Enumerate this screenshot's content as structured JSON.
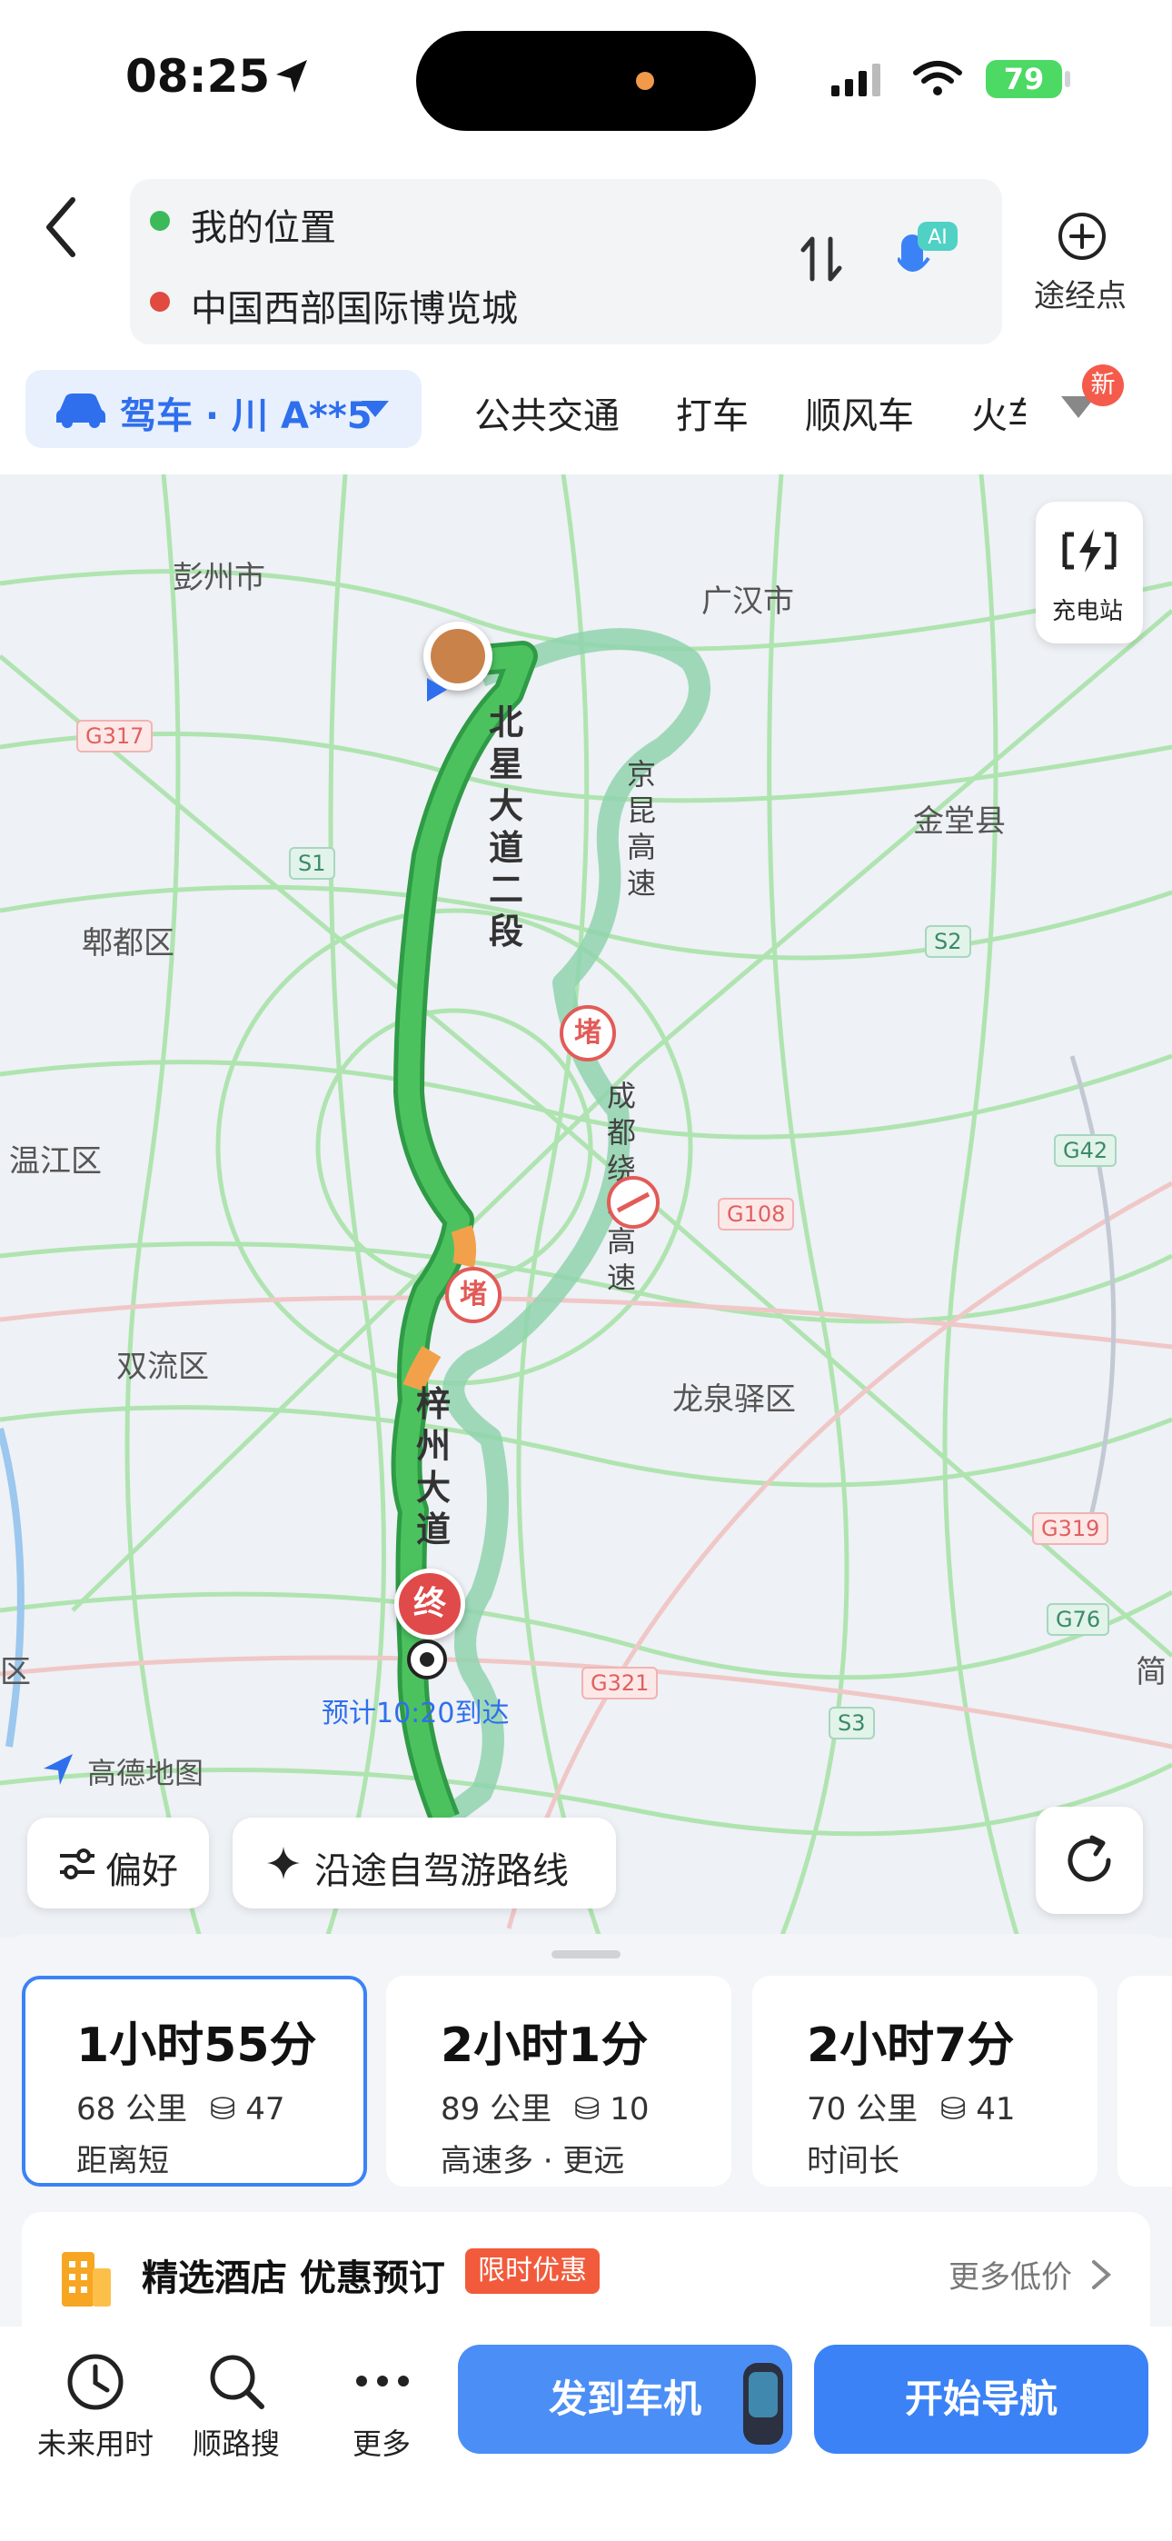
{
  "status_bar": {
    "time": "08:25",
    "battery": "79"
  },
  "header": {
    "origin": "我的位置",
    "destination": "中国西部国际博览城",
    "waypoint_label": "途经点"
  },
  "modes": {
    "drive": "驾车 · 川 A**5",
    "tabs": [
      "公共交通",
      "打车",
      "顺风车",
      "火车"
    ],
    "new_badge": "新"
  },
  "map": {
    "charging_label": "充电站",
    "places": [
      "彭州市",
      "广汉市",
      "金堂县",
      "郫都区",
      "温江区",
      "双流区",
      "龙泉驿区",
      "区",
      "简"
    ],
    "road_badges": [
      "G317",
      "S1",
      "S2",
      "G42",
      "G108",
      "G319",
      "G76",
      "G321",
      "S3"
    ],
    "road_names": [
      "北星大道二段",
      "京昆高速",
      "成都绕城高速",
      "梓州大道"
    ],
    "jam_label": "堵",
    "end_label": "终",
    "eta": "预计10:20到达",
    "brand": "高德地图"
  },
  "chips": {
    "preference": "偏好",
    "scenic": "沿途自驾游路线"
  },
  "routes": [
    {
      "time": "1小时55分",
      "distance": "68 公里",
      "lights": "47",
      "tag": "距离短"
    },
    {
      "time": "2小时1分",
      "distance": "89 公里",
      "lights": "10",
      "tag": "高速多 · 更远"
    },
    {
      "time": "2小时7分",
      "distance": "70 公里",
      "lights": "41",
      "tag": "时间长"
    }
  ],
  "hotel": {
    "title": "精选酒店 优惠预订",
    "badge": "限时优惠",
    "more": "更多低价"
  },
  "bottom": {
    "later": "未来用时",
    "search_along": "顺路搜",
    "more": "更多",
    "send_to_car": "发到车机",
    "start_nav": "开始导航"
  },
  "colors": {
    "accent": "#2f6fed",
    "route_main": "#3cb454",
    "route_alt": "#9fd8b8",
    "jam": "#e25b57"
  }
}
